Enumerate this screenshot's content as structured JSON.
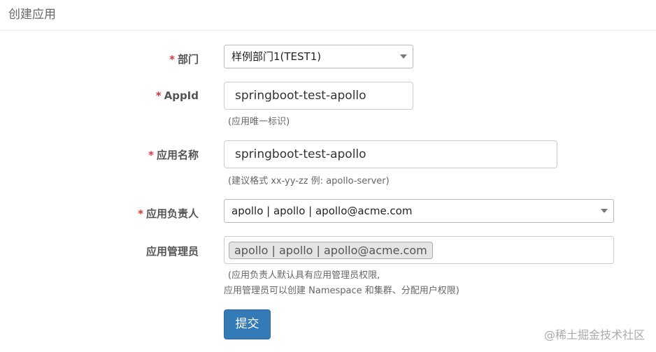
{
  "page": {
    "title": "创建应用"
  },
  "form": {
    "required_mark": "*",
    "department": {
      "label": "部门",
      "value": "样例部门1(TEST1)"
    },
    "app_id": {
      "label": "AppId",
      "value": "springboot-test-apollo",
      "help": "(应用唯一标识)"
    },
    "app_name": {
      "label": "应用名称",
      "value": "springboot-test-apollo",
      "help": "(建议格式 xx-yy-zz 例: apollo-server)"
    },
    "owner": {
      "label": "应用负责人",
      "value": "apollo | apollo | apollo@acme.com"
    },
    "admins": {
      "label": "应用管理员",
      "tags": [
        "apollo | apollo | apollo@acme.com"
      ],
      "help_line1": "(应用负责人默认具有应用管理员权限,",
      "help_line2": "应用管理员可以创建 Namespace 和集群、分配用户权限)"
    },
    "submit_label": "提交"
  },
  "watermark": "@稀土掘金技术社区"
}
